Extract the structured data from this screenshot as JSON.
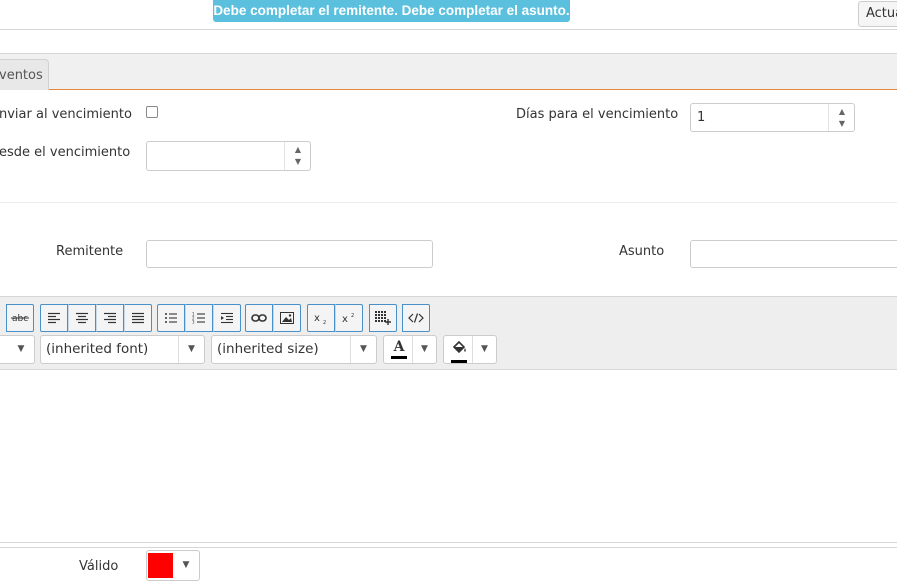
{
  "banner": {
    "text": "Debe completar el remitente. Debe completar el asunto."
  },
  "header": {
    "refresh_button": "Actua"
  },
  "tabs": [
    {
      "label": "ventos"
    }
  ],
  "form": {
    "send_on_expiry_label": "nviar al vencimiento",
    "send_on_expiry_checked": false,
    "days_to_expiry_label": "Días para el vencimiento",
    "days_to_expiry_value": "1",
    "since_expiry_label": "esde el vencimiento",
    "since_expiry_value": "",
    "sender_label": "Remitente",
    "sender_value": "",
    "subject_label": "Asunto",
    "subject_value": ""
  },
  "editor": {
    "font_select": "(inherited font)",
    "size_select": "(inherited size)",
    "toolbar_icons": [
      "strikethrough-icon",
      "align-left-icon",
      "align-center-icon",
      "align-right-icon",
      "align-justify-icon",
      "bullet-list-icon",
      "numbered-list-icon",
      "indent-icon",
      "link-icon",
      "image-icon",
      "subscript-icon",
      "superscript-icon",
      "table-icon",
      "view-html-icon",
      "font-color-icon",
      "background-color-icon"
    ],
    "font_color_letter": "A",
    "body_text": ""
  },
  "footer": {
    "valid_label": "Válido",
    "valid_color": "#ff0000"
  },
  "colors": {
    "banner_bg": "#5bc0de",
    "tab_accent": "#e8883a",
    "toolbar_button_border": "#4a90c8",
    "valid_swatch": "#ff0000"
  }
}
